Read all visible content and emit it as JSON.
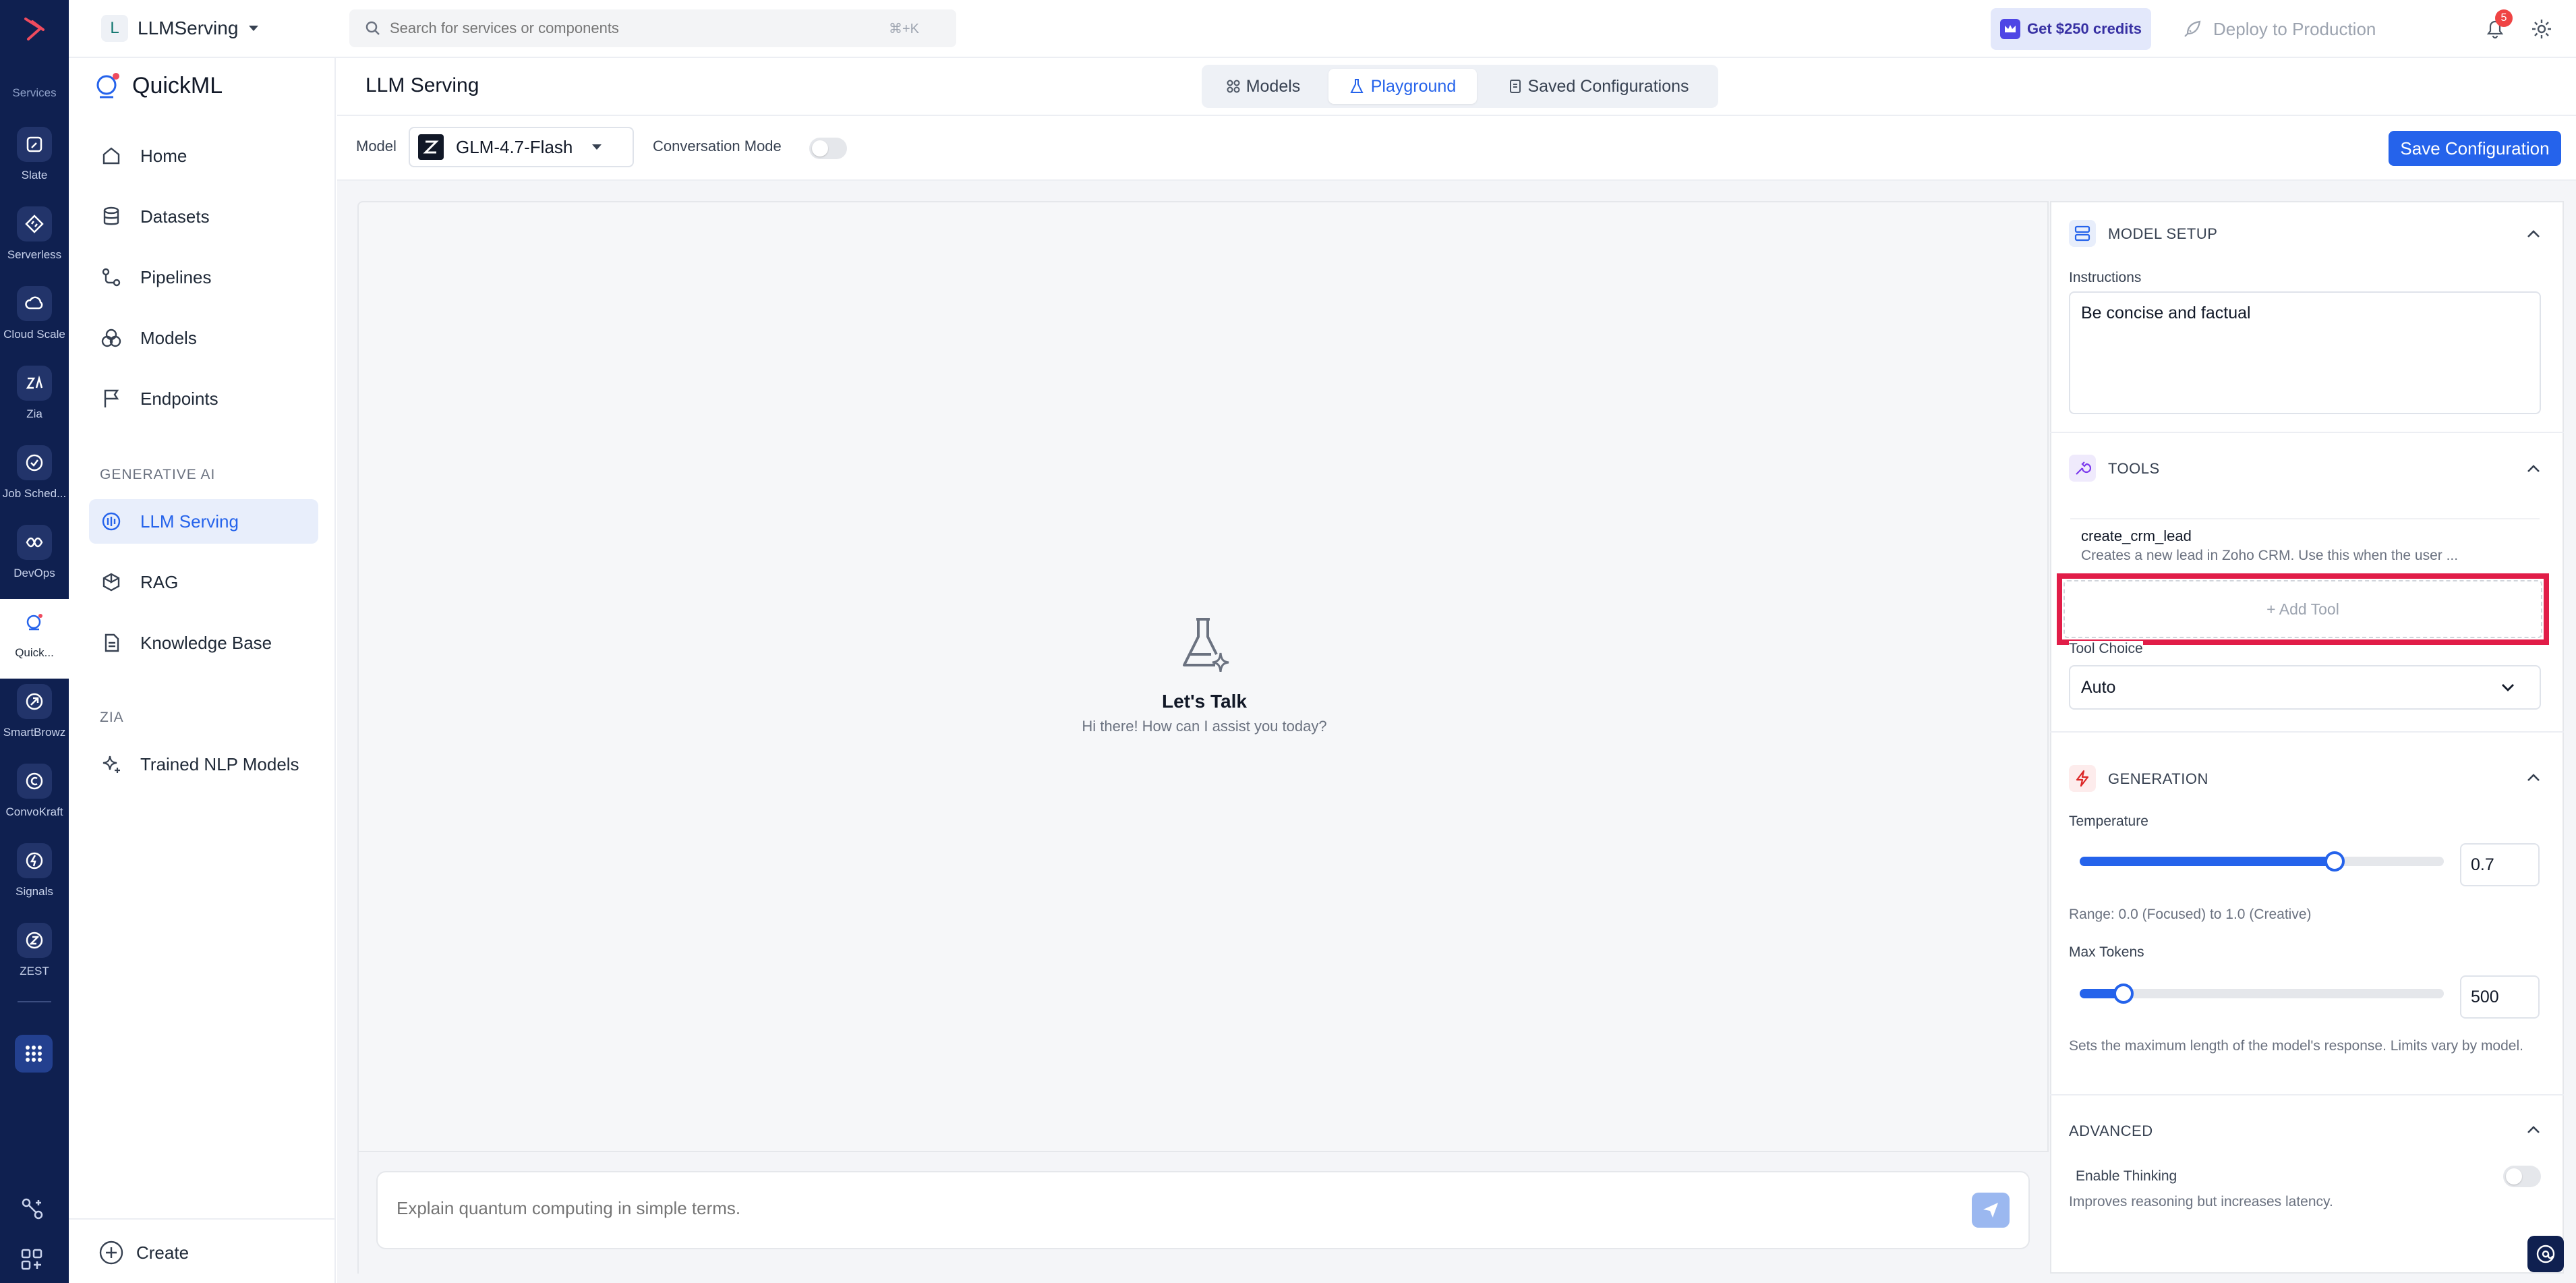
{
  "rail": {
    "services_label": "Services",
    "items": [
      {
        "label": "Slate",
        "icon": "slate-icon"
      },
      {
        "label": "Serverless",
        "icon": "serverless-icon"
      },
      {
        "label": "Cloud Scale",
        "icon": "cloud-scale-icon"
      },
      {
        "label": "Zia",
        "icon": "zia-icon"
      },
      {
        "label": "Job Sched...",
        "icon": "job-scheduler-icon"
      },
      {
        "label": "DevOps",
        "icon": "devops-icon"
      },
      {
        "label": "Quick...",
        "icon": "quickml-icon"
      },
      {
        "label": "SmartBrowz",
        "icon": "smartbrowz-icon"
      },
      {
        "label": "ConvoKraft",
        "icon": "convokraft-icon"
      },
      {
        "label": "Signals",
        "icon": "signals-icon"
      },
      {
        "label": "ZEST",
        "icon": "zest-icon"
      }
    ]
  },
  "project": {
    "initial": "L",
    "name": "LLMServing"
  },
  "search": {
    "placeholder": "Search for services or components",
    "shortcut": "⌘+K"
  },
  "header_actions": {
    "credits": "Get $250 credits",
    "deploy": "Deploy to Production",
    "notifications_count": "5"
  },
  "sidebar": {
    "app_name": "QuickML",
    "items": [
      {
        "label": "Home"
      },
      {
        "label": "Datasets"
      },
      {
        "label": "Pipelines"
      },
      {
        "label": "Models"
      },
      {
        "label": "Endpoints"
      }
    ],
    "gen_ai_title": "GENERATIVE AI",
    "gen_ai_items": [
      {
        "label": "LLM Serving"
      },
      {
        "label": "RAG"
      },
      {
        "label": "Knowledge Base"
      }
    ],
    "zia_title": "ZIA",
    "zia_items": [
      {
        "label": "Trained NLP Models"
      }
    ],
    "create_label": "Create"
  },
  "page": {
    "title": "LLM Serving",
    "tabs": [
      {
        "label": "Models"
      },
      {
        "label": "Playground"
      },
      {
        "label": "Saved Configurations"
      }
    ]
  },
  "toolbar": {
    "model_label": "Model",
    "model_value": "GLM-4.7-Flash",
    "conversation_mode_label": "Conversation Mode",
    "save_label": "Save Configuration"
  },
  "chat": {
    "empty_title": "Let's Talk",
    "empty_subtitle": "Hi there! How can I assist you today?",
    "input_placeholder": "Explain quantum computing in simple terms."
  },
  "panel": {
    "model_setup": {
      "title": "MODEL SETUP",
      "instructions_label": "Instructions",
      "instructions_value": "Be concise and factual"
    },
    "tools": {
      "title": "TOOLS",
      "items": [
        {
          "name": "create_crm_lead",
          "description": "Creates a new lead in Zoho CRM. Use this when the user ..."
        }
      ],
      "add_tool": "+ Add Tool",
      "tool_choice_label": "Tool Choice",
      "tool_choice_value": "Auto"
    },
    "generation": {
      "title": "GENERATION",
      "temperature_label": "Temperature",
      "temperature_value": "0.7",
      "temperature_fraction": 0.7,
      "temperature_hint": "Range: 0.0 (Focused) to 1.0 (Creative)",
      "max_tokens_label": "Max Tokens",
      "max_tokens_value": "500",
      "max_tokens_fraction": 0.12,
      "max_tokens_hint": "Sets the maximum length of the model's response. Limits vary by model."
    },
    "advanced": {
      "title": "ADVANCED",
      "thinking_label": "Enable Thinking",
      "thinking_hint": "Improves reasoning but increases latency."
    }
  },
  "colors": {
    "accent": "#2563eb",
    "rail_bg": "#0f2050",
    "highlight": "#e11d48"
  }
}
